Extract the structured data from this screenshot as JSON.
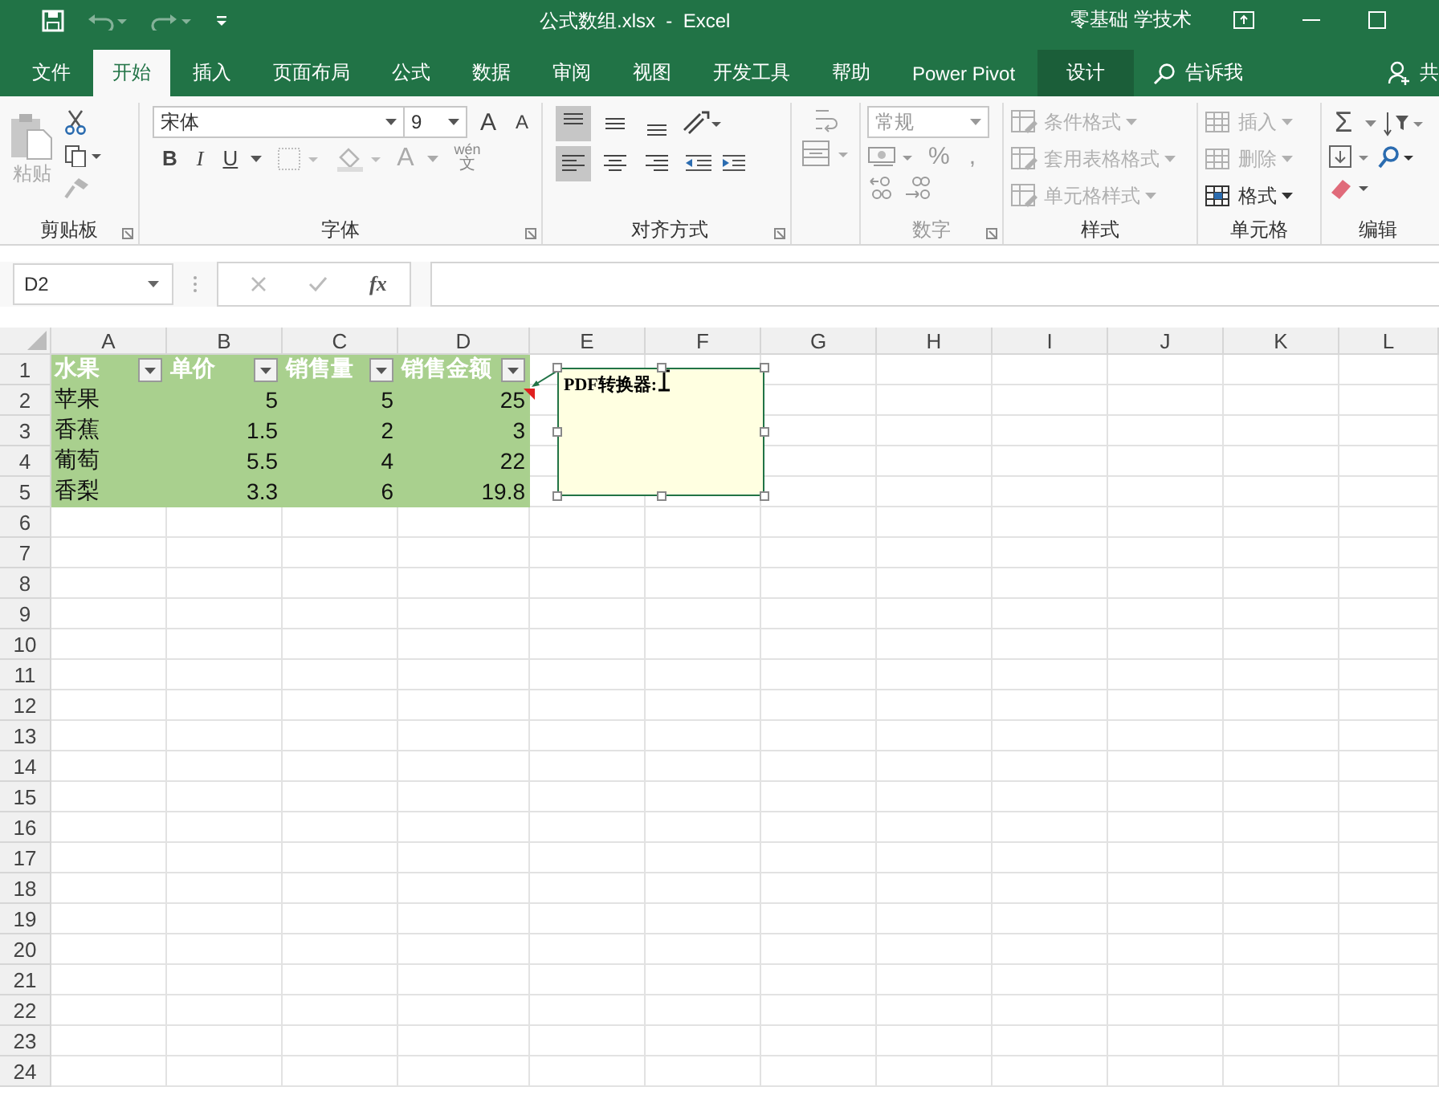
{
  "title_bar": {
    "title": "公式数组.xlsx  -  Excel",
    "user": "零基础 学技术"
  },
  "tabs": [
    {
      "label": "文件",
      "selected": false,
      "kind": "normal"
    },
    {
      "label": "开始",
      "selected": true,
      "kind": "normal"
    },
    {
      "label": "插入",
      "selected": false,
      "kind": "normal"
    },
    {
      "label": "页面布局",
      "selected": false,
      "kind": "normal"
    },
    {
      "label": "公式",
      "selected": false,
      "kind": "normal"
    },
    {
      "label": "数据",
      "selected": false,
      "kind": "normal"
    },
    {
      "label": "审阅",
      "selected": false,
      "kind": "normal"
    },
    {
      "label": "视图",
      "selected": false,
      "kind": "normal"
    },
    {
      "label": "开发工具",
      "selected": false,
      "kind": "normal"
    },
    {
      "label": "帮助",
      "selected": false,
      "kind": "normal"
    },
    {
      "label": "Power Pivot",
      "selected": false,
      "kind": "normal"
    },
    {
      "label": "设计",
      "selected": false,
      "kind": "contextual"
    }
  ],
  "tell_me": "告诉我",
  "share": "共",
  "ribbon": {
    "clipboard": {
      "paste": "粘贴",
      "paste_disabled": true,
      "label": "剪贴板"
    },
    "font": {
      "name": "宋体",
      "size": "9",
      "grow": "A",
      "shrink": "A",
      "bold": "B",
      "italic": "I",
      "underline": "U",
      "font_color": "A",
      "phonetic": "wén",
      "phonetic_char": "文",
      "label": "字体"
    },
    "alignment": {
      "label": "对齐方式"
    },
    "number": {
      "format": "常规",
      "disabled": true,
      "percent": "%",
      "comma": ",",
      "label": "数字"
    },
    "styles": {
      "items": [
        {
          "label": "条件格式",
          "disabled": true
        },
        {
          "label": "套用表格格式",
          "disabled": true
        },
        {
          "label": "单元格样式",
          "disabled": true
        }
      ],
      "label": "样式"
    },
    "cells": {
      "items": [
        {
          "label": "插入",
          "disabled": true
        },
        {
          "label": "删除",
          "disabled": true
        },
        {
          "label": "格式",
          "disabled": false
        }
      ],
      "label": "单元格"
    },
    "editing": {
      "sum": "Σ",
      "label": "编辑"
    }
  },
  "formula_bar": {
    "name_box": "D2",
    "fx": "fx"
  },
  "columns": [
    "A",
    "B",
    "C",
    "D",
    "E",
    "F",
    "G",
    "H",
    "I",
    "J",
    "K",
    "L"
  ],
  "row_numbers": [
    "1",
    "2",
    "3",
    "4",
    "5",
    "6",
    "7",
    "8",
    "9",
    "10",
    "11",
    "12",
    "13",
    "14",
    "15",
    "16",
    "17",
    "18",
    "19",
    "20",
    "21",
    "22",
    "23",
    "24"
  ],
  "table": {
    "header": [
      "水果",
      "单价",
      "销售量",
      "销售金额"
    ],
    "rows": [
      [
        "苹果",
        "5",
        "5",
        "25"
      ],
      [
        "香蕉",
        "1.5",
        "2",
        "3"
      ],
      [
        "葡萄",
        "5.5",
        "4",
        "22"
      ],
      [
        "香梨",
        "3.3",
        "6",
        "19.8"
      ]
    ]
  },
  "comment": {
    "text": "PDF转换器:"
  }
}
